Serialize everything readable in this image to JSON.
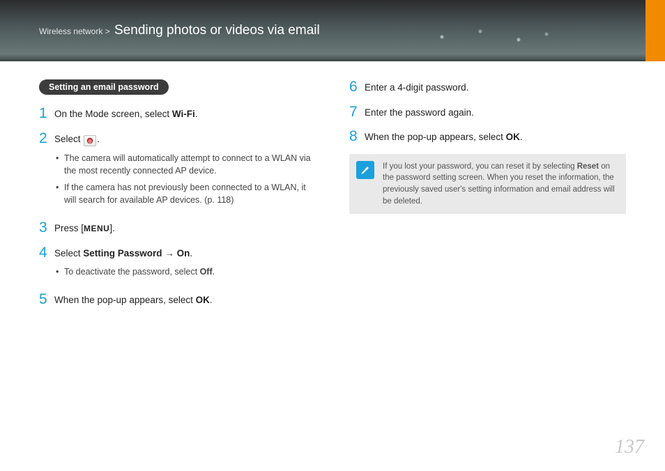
{
  "header": {
    "breadcrumb_prefix": "Wireless network > ",
    "title": "Sending photos or videos via email"
  },
  "section_heading": "Setting an email password",
  "left_steps": {
    "s1": {
      "num": "1",
      "pre": "On the Mode screen, select ",
      "bold": "Wi-Fi",
      "post": "."
    },
    "s2": {
      "num": "2",
      "pre": "Select ",
      "post": ".",
      "sub1": "The camera will automatically attempt to connect to a WLAN via the most recently connected AP device.",
      "sub2": "If the camera has not previously been connected to a WLAN, it will search for available AP devices. (p. 118)"
    },
    "s3": {
      "num": "3",
      "pre": "Press [",
      "menu": "MENU",
      "post": "]."
    },
    "s4": {
      "num": "4",
      "pre": "Select ",
      "bold": "Setting Password",
      "arrow": " → ",
      "bold2": "On",
      "post": ".",
      "sub1_pre": "To deactivate the password, select ",
      "sub1_bold": "Off",
      "sub1_post": "."
    },
    "s5": {
      "num": "5",
      "pre": "When the pop-up appears, select ",
      "bold": "OK",
      "post": "."
    }
  },
  "right_steps": {
    "s6": {
      "num": "6",
      "text": "Enter a 4-digit password."
    },
    "s7": {
      "num": "7",
      "text": "Enter the password again."
    },
    "s8": {
      "num": "8",
      "pre": "When the pop-up appears, select ",
      "bold": "OK",
      "post": "."
    }
  },
  "note": {
    "pre": "If you lost your password, you can reset it by selecting ",
    "bold": "Reset",
    "post": " on the password setting screen. When you reset the information, the previously saved user's setting information and email address will be deleted."
  },
  "page_number": "137"
}
